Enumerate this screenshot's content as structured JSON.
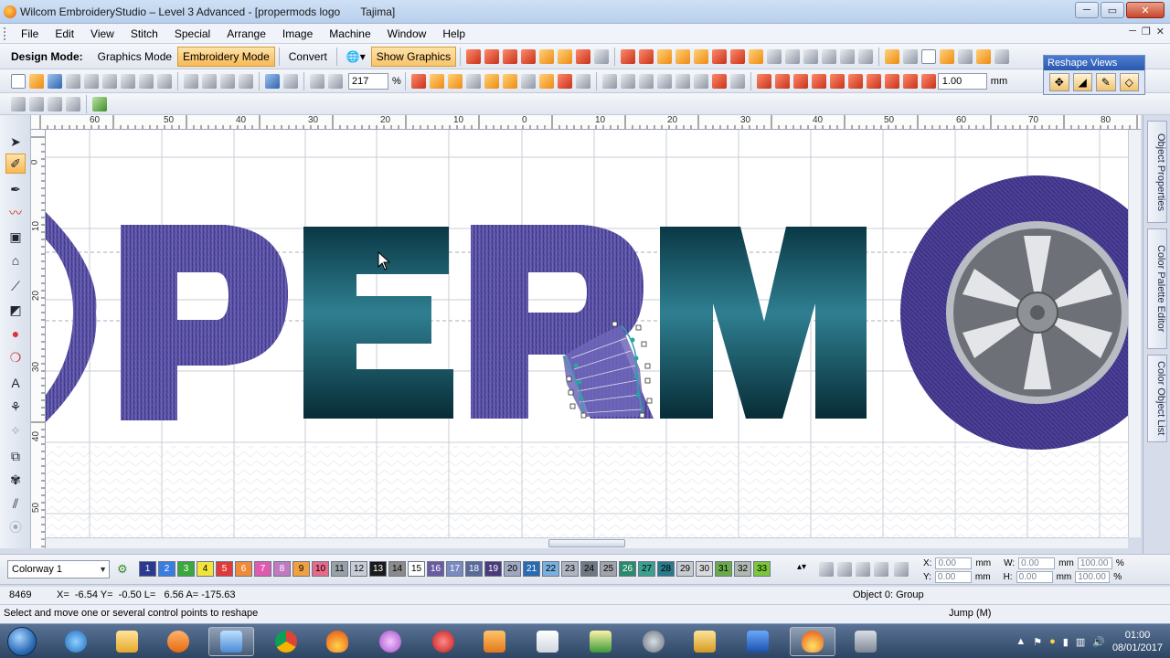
{
  "window": {
    "title": "Wilcom EmbroideryStudio – Level 3 Advanced - [propermods logo",
    "machine": "Tajima]"
  },
  "menu": [
    "File",
    "Edit",
    "View",
    "Stitch",
    "Special",
    "Arrange",
    "Image",
    "Machine",
    "Window",
    "Help"
  ],
  "toolbar": {
    "design_mode_label": "Design Mode:",
    "graphics_mode": "Graphics Mode",
    "embroidery_mode": "Embroidery Mode",
    "convert": "Convert",
    "show_graphics": "Show Graphics",
    "zoom_value": "217",
    "zoom_unit": "%",
    "scale_value": "1.00",
    "scale_unit": "mm"
  },
  "reshape_views": {
    "title": "Reshape Views"
  },
  "ruler": {
    "top_ticks": [
      "60",
      "50",
      "40",
      "30",
      "20",
      "10",
      "0",
      "10",
      "20",
      "30",
      "40",
      "50",
      "60",
      "70",
      "80"
    ],
    "left_ticks": [
      "0",
      "10",
      "20",
      "30",
      "40",
      "50"
    ]
  },
  "side_tabs": [
    "Object Properties",
    "Color Palette Editor",
    "Color Object List"
  ],
  "colorway": {
    "name": "Colorway 1",
    "swatches": [
      {
        "n": "1",
        "color": "#2b3a8f",
        "fg": "#ffffff"
      },
      {
        "n": "2",
        "color": "#3a7de0",
        "fg": "#ffffff"
      },
      {
        "n": "3",
        "color": "#3aa83a",
        "fg": "#ffffff"
      },
      {
        "n": "4",
        "color": "#f2e43a",
        "fg": "#000000"
      },
      {
        "n": "5",
        "color": "#e03a3a",
        "fg": "#ffffff"
      },
      {
        "n": "6",
        "color": "#f08a3a",
        "fg": "#ffffff"
      },
      {
        "n": "7",
        "color": "#e05ab0",
        "fg": "#ffffff"
      },
      {
        "n": "8",
        "color": "#c07ac0",
        "fg": "#ffffff"
      },
      {
        "n": "9",
        "color": "#f0a040",
        "fg": "#000000"
      },
      {
        "n": "10",
        "color": "#e86a8a",
        "fg": "#000000"
      },
      {
        "n": "11",
        "color": "#9aa0a8",
        "fg": "#000000"
      },
      {
        "n": "12",
        "color": "#c8ccd4",
        "fg": "#000000"
      },
      {
        "n": "13",
        "color": "#1a1a1a",
        "fg": "#ffffff"
      },
      {
        "n": "14",
        "color": "#8a8a8a",
        "fg": "#000000"
      },
      {
        "n": "15",
        "color": "#ffffff",
        "fg": "#000000"
      },
      {
        "n": "16",
        "color": "#6a5aa0",
        "fg": "#ffffff"
      },
      {
        "n": "17",
        "color": "#7a8ac0",
        "fg": "#ffffff"
      },
      {
        "n": "18",
        "color": "#5a6a9a",
        "fg": "#ffffff"
      },
      {
        "n": "19",
        "color": "#4a3a7a",
        "fg": "#ffffff"
      },
      {
        "n": "20",
        "color": "#a0a8c0",
        "fg": "#000000"
      },
      {
        "n": "21",
        "color": "#2a6ab0",
        "fg": "#ffffff"
      },
      {
        "n": "22",
        "color": "#7ab0e0",
        "fg": "#000000"
      },
      {
        "n": "23",
        "color": "#b0b4c0",
        "fg": "#000000"
      },
      {
        "n": "24",
        "color": "#707880",
        "fg": "#000000"
      },
      {
        "n": "25",
        "color": "#a0a4aa",
        "fg": "#000000"
      },
      {
        "n": "26",
        "color": "#2a8a6a",
        "fg": "#ffffff"
      },
      {
        "n": "27",
        "color": "#3aa090",
        "fg": "#000000"
      },
      {
        "n": "28",
        "color": "#2a7a8a",
        "fg": "#000000"
      },
      {
        "n": "29",
        "color": "#c8ccd0",
        "fg": "#000000"
      },
      {
        "n": "30",
        "color": "#d8dadc",
        "fg": "#000000"
      },
      {
        "n": "31",
        "color": "#6aaa4a",
        "fg": "#000000"
      },
      {
        "n": "32",
        "color": "#b0b8b0",
        "fg": "#000000"
      },
      {
        "n": "33",
        "color": "#7ac83a",
        "fg": "#000000"
      }
    ]
  },
  "fields": {
    "x_label": "X:",
    "x_value": "0.00",
    "x_unit": "mm",
    "y_label": "Y:",
    "y_value": "0.00",
    "y_unit": "mm",
    "w_label": "W:",
    "w_value": "0.00",
    "w_unit": "mm",
    "h_label": "H:",
    "h_value": "0.00",
    "h_unit": "mm",
    "pct1": "100.00",
    "pct2": "100.00",
    "pct_unit": "%"
  },
  "status": {
    "stitch_count": "8469",
    "coords": "X=  -6.54 Y=  -0.50 L=   6.56 A= -175.63",
    "object_info": "Object 0: Group",
    "hint": "Select and move one or several control points to reshape",
    "jump": "Jump (M)"
  },
  "taskbar": {
    "time": "01:00",
    "date": "08/01/2017"
  },
  "design": {
    "letters": [
      "P",
      "E",
      "R",
      "M"
    ],
    "colors": {
      "purple": "#5e55a8",
      "teal_dark": "#0b3a47",
      "teal_light": "#2f7d8f",
      "tire": "#4a3f94",
      "hub": "#8e9196"
    }
  }
}
